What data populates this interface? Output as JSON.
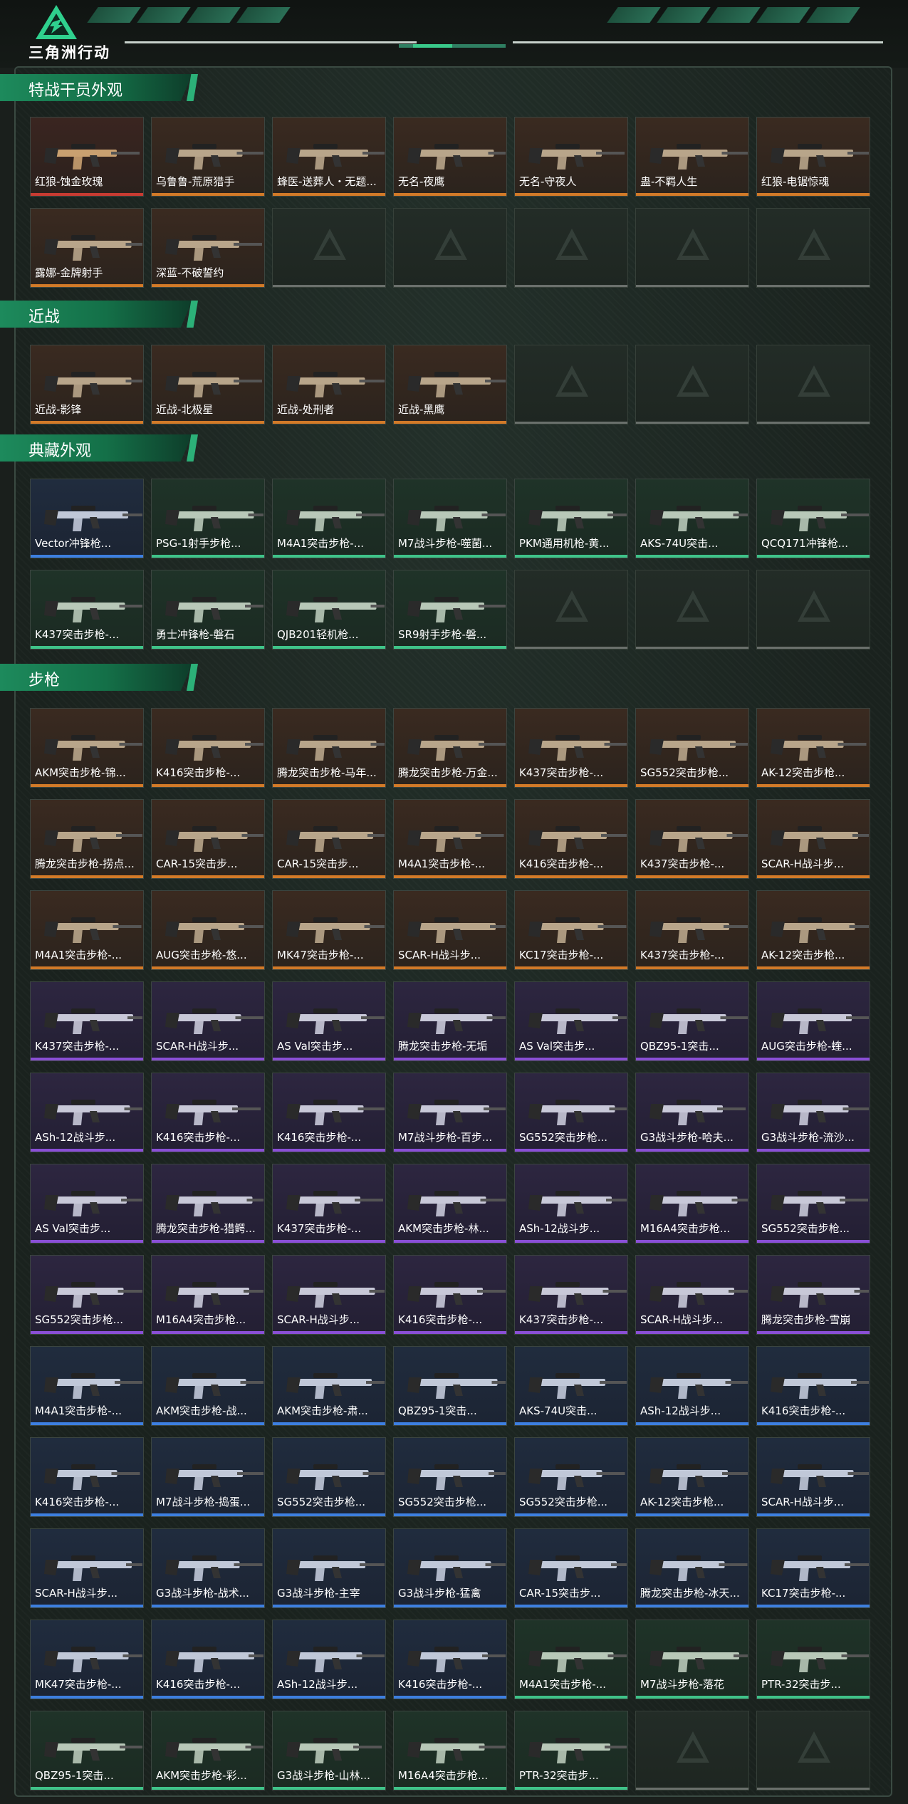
{
  "app": {
    "title": "三角洲行动"
  },
  "colors": {
    "accent": "#2cb078",
    "red": "#c83b32",
    "orange": "#d27a28",
    "purple": "#8a4fd6",
    "blue": "#3d7fe0",
    "green": "#3fc389"
  },
  "sections": [
    {
      "title": "特战干员外观",
      "items": [
        {
          "label": "红狼-蚀金玫瑰",
          "rarity": "red"
        },
        {
          "label": "乌鲁鲁-荒原猎手",
          "rarity": "orange"
        },
        {
          "label": "蜂医-送葬人・无题...",
          "rarity": "orange"
        },
        {
          "label": "无名-夜鹰",
          "rarity": "orange"
        },
        {
          "label": "无名-守夜人",
          "rarity": "orange"
        },
        {
          "label": "蛊-不羁人生",
          "rarity": "orange"
        },
        {
          "label": "红狼-电锯惊魂",
          "rarity": "orange"
        },
        {
          "label": "露娜-金牌射手",
          "rarity": "orange"
        },
        {
          "label": "深蓝-不破誓约",
          "rarity": "orange"
        }
      ],
      "empty_slots": 5
    },
    {
      "title": "近战",
      "items": [
        {
          "label": "近战-影锋",
          "rarity": "orange"
        },
        {
          "label": "近战-北极星",
          "rarity": "orange"
        },
        {
          "label": "近战-处刑者",
          "rarity": "orange"
        },
        {
          "label": "近战-黑鹰",
          "rarity": "orange"
        }
      ],
      "empty_slots": 3
    },
    {
      "title": "典藏外观",
      "items": [
        {
          "label": "Vector冲锋枪...",
          "rarity": "blue"
        },
        {
          "label": "PSG-1射手步枪...",
          "rarity": "green"
        },
        {
          "label": "M4A1突击步枪-...",
          "rarity": "green"
        },
        {
          "label": "M7战斗步枪-噬菌...",
          "rarity": "green"
        },
        {
          "label": "PKM通用机枪-黄...",
          "rarity": "green"
        },
        {
          "label": "AKS-74U突击...",
          "rarity": "green"
        },
        {
          "label": "QCQ171冲锋枪...",
          "rarity": "green"
        },
        {
          "label": "K437突击步枪-...",
          "rarity": "green"
        },
        {
          "label": "勇士冲锋枪-磐石",
          "rarity": "green"
        },
        {
          "label": "QJB201轻机枪...",
          "rarity": "green"
        },
        {
          "label": "SR9射手步枪-磐...",
          "rarity": "green"
        }
      ],
      "empty_slots": 3
    },
    {
      "title": "步枪",
      "items": [
        {
          "label": "AKM突击步枪-锦...",
          "rarity": "orange"
        },
        {
          "label": "K416突击步枪-...",
          "rarity": "orange"
        },
        {
          "label": "腾龙突击步枪-马年...",
          "rarity": "orange"
        },
        {
          "label": "腾龙突击步枪-万金...",
          "rarity": "orange"
        },
        {
          "label": "K437突击步枪-...",
          "rarity": "orange"
        },
        {
          "label": "SG552突击步枪...",
          "rarity": "orange"
        },
        {
          "label": "AK-12突击步枪...",
          "rarity": "orange"
        },
        {
          "label": "腾龙突击步枪-捞点...",
          "rarity": "orange"
        },
        {
          "label": "CAR-15突击步...",
          "rarity": "orange"
        },
        {
          "label": "CAR-15突击步...",
          "rarity": "orange"
        },
        {
          "label": "M4A1突击步枪-...",
          "rarity": "orange"
        },
        {
          "label": "K416突击步枪-...",
          "rarity": "orange"
        },
        {
          "label": "K437突击步枪-...",
          "rarity": "orange"
        },
        {
          "label": "SCAR-H战斗步...",
          "rarity": "orange"
        },
        {
          "label": "M4A1突击步枪-...",
          "rarity": "orange"
        },
        {
          "label": "AUG突击步枪-悠...",
          "rarity": "orange"
        },
        {
          "label": "MK47突击步枪-...",
          "rarity": "orange"
        },
        {
          "label": "SCAR-H战斗步...",
          "rarity": "orange"
        },
        {
          "label": "KC17突击步枪-...",
          "rarity": "orange"
        },
        {
          "label": "K437突击步枪-...",
          "rarity": "orange"
        },
        {
          "label": "AK-12突击步枪...",
          "rarity": "orange"
        },
        {
          "label": "K437突击步枪-...",
          "rarity": "purple"
        },
        {
          "label": "SCAR-H战斗步...",
          "rarity": "purple"
        },
        {
          "label": "AS Val突击步...",
          "rarity": "purple"
        },
        {
          "label": "腾龙突击步枪-无垢",
          "rarity": "purple"
        },
        {
          "label": "AS Val突击步...",
          "rarity": "purple"
        },
        {
          "label": "QBZ95-1突击...",
          "rarity": "purple"
        },
        {
          "label": "AUG突击步枪-蝰...",
          "rarity": "purple"
        },
        {
          "label": "ASh-12战斗步...",
          "rarity": "purple"
        },
        {
          "label": "K416突击步枪-...",
          "rarity": "purple"
        },
        {
          "label": "K416突击步枪-...",
          "rarity": "purple"
        },
        {
          "label": "M7战斗步枪-百步...",
          "rarity": "purple"
        },
        {
          "label": "SG552突击步枪...",
          "rarity": "purple"
        },
        {
          "label": "G3战斗步枪-哈夫...",
          "rarity": "purple"
        },
        {
          "label": "G3战斗步枪-流沙...",
          "rarity": "purple"
        },
        {
          "label": "AS Val突击步...",
          "rarity": "purple"
        },
        {
          "label": "腾龙突击步枪-猎鳄...",
          "rarity": "purple"
        },
        {
          "label": "K437突击步枪-...",
          "rarity": "purple"
        },
        {
          "label": "AKM突击步枪-林...",
          "rarity": "purple"
        },
        {
          "label": "ASh-12战斗步...",
          "rarity": "purple"
        },
        {
          "label": "M16A4突击步枪...",
          "rarity": "purple"
        },
        {
          "label": "SG552突击步枪...",
          "rarity": "purple"
        },
        {
          "label": "SG552突击步枪...",
          "rarity": "purple"
        },
        {
          "label": "M16A4突击步枪...",
          "rarity": "purple"
        },
        {
          "label": "SCAR-H战斗步...",
          "rarity": "purple"
        },
        {
          "label": "K416突击步枪-...",
          "rarity": "purple"
        },
        {
          "label": "K437突击步枪-...",
          "rarity": "purple"
        },
        {
          "label": "SCAR-H战斗步...",
          "rarity": "purple"
        },
        {
          "label": "腾龙突击步枪-雪崩",
          "rarity": "purple"
        },
        {
          "label": "M4A1突击步枪-...",
          "rarity": "blue"
        },
        {
          "label": "AKM突击步枪-战...",
          "rarity": "blue"
        },
        {
          "label": "AKM突击步枪-肃...",
          "rarity": "blue"
        },
        {
          "label": "QBZ95-1突击...",
          "rarity": "blue"
        },
        {
          "label": "AKS-74U突击...",
          "rarity": "blue"
        },
        {
          "label": "ASh-12战斗步...",
          "rarity": "blue"
        },
        {
          "label": "K416突击步枪-...",
          "rarity": "blue"
        },
        {
          "label": "K416突击步枪-...",
          "rarity": "blue"
        },
        {
          "label": "M7战斗步枪-捣蛋...",
          "rarity": "blue"
        },
        {
          "label": "SG552突击步枪...",
          "rarity": "blue"
        },
        {
          "label": "SG552突击步枪...",
          "rarity": "blue"
        },
        {
          "label": "SG552突击步枪...",
          "rarity": "blue"
        },
        {
          "label": "AK-12突击步枪...",
          "rarity": "blue"
        },
        {
          "label": "SCAR-H战斗步...",
          "rarity": "blue"
        },
        {
          "label": "SCAR-H战斗步...",
          "rarity": "blue"
        },
        {
          "label": "G3战斗步枪-战术...",
          "rarity": "blue"
        },
        {
          "label": "G3战斗步枪-主宰",
          "rarity": "blue"
        },
        {
          "label": "G3战斗步枪-猛禽",
          "rarity": "blue"
        },
        {
          "label": "CAR-15突击步...",
          "rarity": "blue"
        },
        {
          "label": "腾龙突击步枪-冰天...",
          "rarity": "blue"
        },
        {
          "label": "KC17突击步枪-...",
          "rarity": "blue"
        },
        {
          "label": "MK47突击步枪-...",
          "rarity": "blue"
        },
        {
          "label": "K416突击步枪-...",
          "rarity": "blue"
        },
        {
          "label": "ASh-12战斗步...",
          "rarity": "blue"
        },
        {
          "label": "K416突击步枪-...",
          "rarity": "blue"
        },
        {
          "label": "M4A1突击步枪-...",
          "rarity": "green"
        },
        {
          "label": "M7战斗步枪-落花",
          "rarity": "green"
        },
        {
          "label": "PTR-32突击步...",
          "rarity": "green"
        },
        {
          "label": "QBZ95-1突击...",
          "rarity": "green"
        },
        {
          "label": "AKM突击步枪-彩...",
          "rarity": "green"
        },
        {
          "label": "G3战斗步枪-山林...",
          "rarity": "green"
        },
        {
          "label": "M16A4突击步枪...",
          "rarity": "green"
        },
        {
          "label": "PTR-32突击步...",
          "rarity": "green"
        }
      ],
      "empty_slots": 2
    }
  ]
}
